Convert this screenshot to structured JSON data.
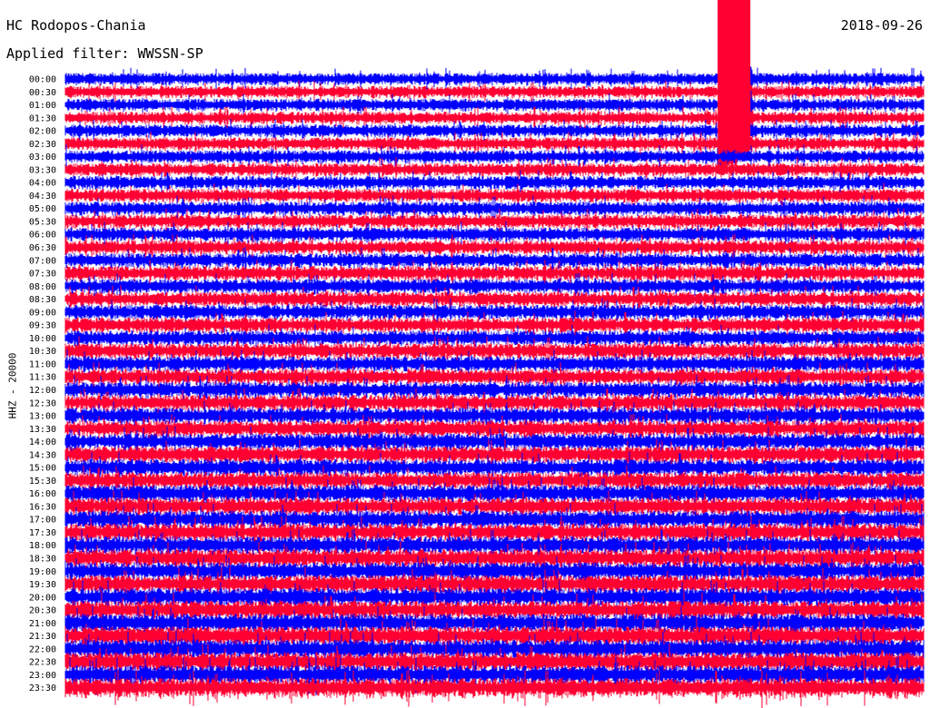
{
  "header": {
    "station": "HC Rodopos-Chania",
    "date": "2018-09-26",
    "filter": "Applied filter: WWSSN-SP"
  },
  "chart_data": {
    "type": "line",
    "title": "HC Rodopos-Chania",
    "ylabel": "HHZ - 20000",
    "series_colors": [
      "#0000ff",
      "#ff0033"
    ],
    "tick_labels": [
      "00:00",
      "00:30",
      "01:00",
      "01:30",
      "02:00",
      "02:30",
      "03:00",
      "03:30",
      "04:00",
      "04:30",
      "05:00",
      "05:30",
      "06:00",
      "06:30",
      "07:00",
      "07:30",
      "08:00",
      "08:30",
      "09:00",
      "09:30",
      "10:00",
      "10:30",
      "11:00",
      "11:30",
      "12:00",
      "12:30",
      "13:00",
      "13:30",
      "14:00",
      "14:30",
      "15:00",
      "15:30",
      "16:00",
      "16:30",
      "17:00",
      "17:30",
      "18:00",
      "18:30",
      "19:00",
      "19:30",
      "20:00",
      "20:30",
      "21:00",
      "21:30",
      "22:00",
      "22:30",
      "23:00",
      "23:30"
    ],
    "event_row": 0,
    "event_position": 0.76,
    "grid": false
  }
}
